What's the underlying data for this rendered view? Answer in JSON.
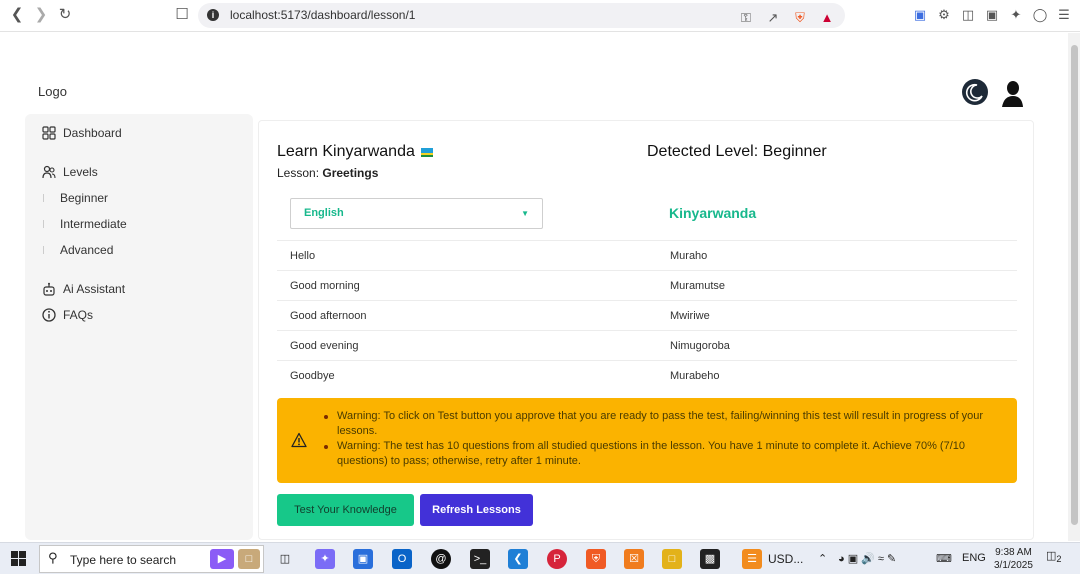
{
  "browser": {
    "url": "localhost:5173/dashboard/lesson/1"
  },
  "page": {
    "logo": "Logo"
  },
  "sidebar": {
    "items": [
      {
        "label": "Dashboard",
        "icon": "grid-icon"
      },
      {
        "label": "Levels",
        "icon": "users-icon"
      },
      {
        "label": "Ai Assistant",
        "icon": "robot-icon"
      },
      {
        "label": "FAQs",
        "icon": "info-icon"
      }
    ],
    "levels": [
      "Beginner",
      "Intermediate",
      "Advanced"
    ]
  },
  "lesson": {
    "title": "Learn Kinyarwanda",
    "lesson_prefix": "Lesson: ",
    "lesson_name": "Greetings",
    "detected_level": "Detected Level: Beginner",
    "source_language": "English",
    "target_language": "Kinyarwanda",
    "rows": [
      {
        "en": "Hello",
        "rw": "Muraho"
      },
      {
        "en": "Good morning",
        "rw": "Muramutse"
      },
      {
        "en": "Good afternoon",
        "rw": "Mwiriwe"
      },
      {
        "en": "Good evening",
        "rw": "Nimugoroba"
      },
      {
        "en": "Goodbye",
        "rw": "Murabeho"
      }
    ]
  },
  "warning": {
    "items": [
      "Warning: To click on Test button you approve that you are ready to pass the test, failing/winning this test will result in progress of your lessons.",
      "Warning: The test has 10 questions from all studied questions in the lesson. You have 1 minute to complete it. Achieve 70% (7/10 questions) to pass; otherwise, retry after 1 minute."
    ]
  },
  "buttons": {
    "test": "Test Your Knowledge",
    "refresh": "Refresh Lessons"
  },
  "taskbar": {
    "search_placeholder": "Type here to search",
    "app_label": "USD...",
    "language": "ENG",
    "time": "9:38 AM",
    "date": "3/1/2025",
    "notification_count": "2"
  },
  "colors": {
    "accent_green": "#17c889",
    "accent_purple": "#4231d8",
    "warning_bg": "#fbb300"
  }
}
